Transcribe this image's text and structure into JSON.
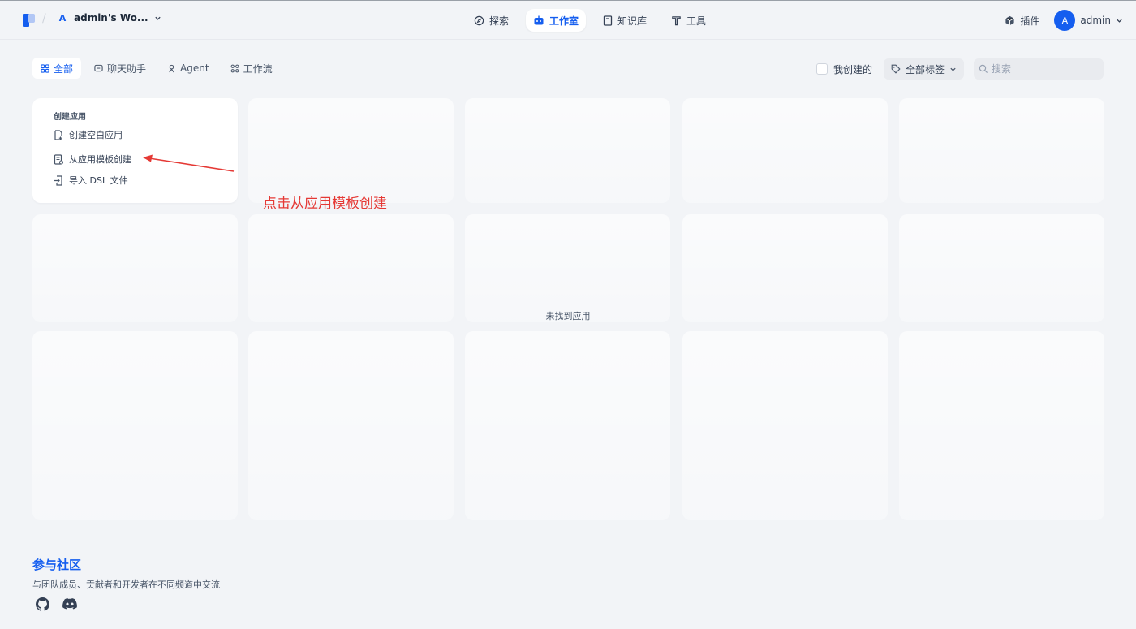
{
  "workspace": {
    "badge": "A",
    "name": "admin's Wo..."
  },
  "nav": [
    {
      "label": "探索",
      "icon": "compass-icon",
      "active": false
    },
    {
      "label": "工作室",
      "icon": "robot-icon",
      "active": true
    },
    {
      "label": "知识库",
      "icon": "book-icon",
      "active": false
    },
    {
      "label": "工具",
      "icon": "hammer-icon",
      "active": false
    }
  ],
  "topright": {
    "plugin_label": "插件",
    "avatar_letter": "A",
    "user_name": "admin"
  },
  "filters": {
    "tabs": [
      {
        "label": "全部",
        "active": true
      },
      {
        "label": "聊天助手",
        "active": false
      },
      {
        "label": "Agent",
        "active": false
      },
      {
        "label": "工作流",
        "active": false
      }
    ],
    "mine_label": "我创建的",
    "tags_label": "全部标签",
    "search_placeholder": "搜索"
  },
  "create": {
    "title": "创建应用",
    "items": [
      {
        "label": "创建空白应用"
      },
      {
        "label": "从应用模板创建"
      },
      {
        "label": "导入 DSL 文件"
      }
    ]
  },
  "empty_text": "未找到应用",
  "annotation": {
    "text": "点击从应用模板创建",
    "color": "#e53935"
  },
  "community": {
    "title": "参与社区",
    "subtitle": "与团队成员、贡献者和开发者在不同频道中交流"
  },
  "colors": {
    "accent": "#155eef",
    "background": "#f2f4f7"
  }
}
